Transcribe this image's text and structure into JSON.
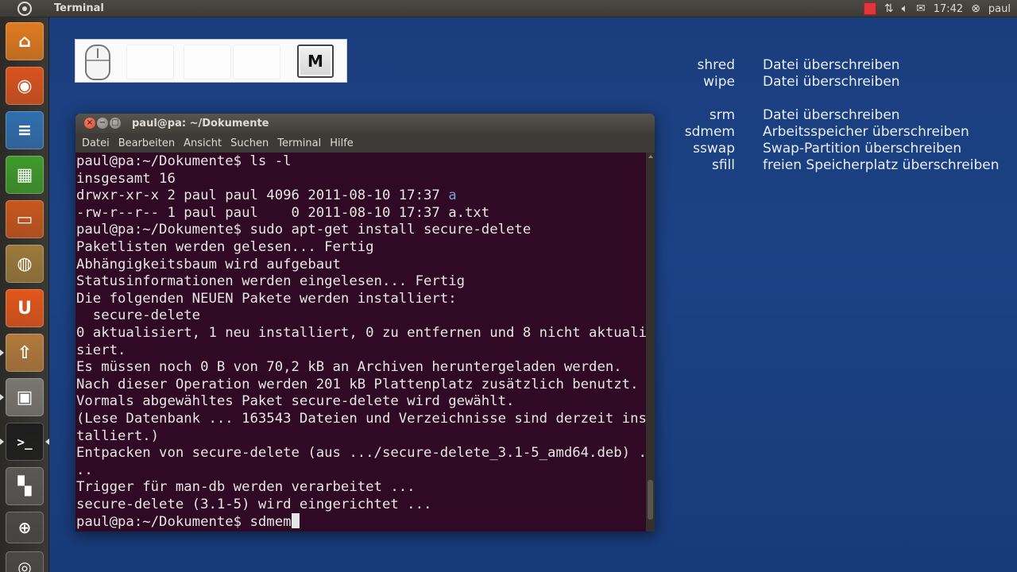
{
  "top_panel": {
    "app_title": "Terminal",
    "clock": "17:42",
    "user": "paul",
    "icons": [
      "ubuntu-logo-icon",
      "record-indicator-icon",
      "network-icon",
      "volume-icon",
      "mail-icon",
      "power-icon"
    ]
  },
  "launcher": {
    "items": [
      {
        "name": "home-folder-icon",
        "color": "#e07b1f",
        "glyph": "⌂"
      },
      {
        "name": "firefox-icon",
        "color": "#d9531e",
        "glyph": "◉"
      },
      {
        "name": "writer-icon",
        "color": "#2f6fb0",
        "glyph": "≡"
      },
      {
        "name": "calc-icon",
        "color": "#3f9a2b",
        "glyph": "▦"
      },
      {
        "name": "impress-icon",
        "color": "#c8561d",
        "glyph": "▭"
      },
      {
        "name": "software-center-icon",
        "color": "#9c7a3a",
        "glyph": "◍"
      },
      {
        "name": "ubuntu-one-icon",
        "color": "#e3561a",
        "glyph": "U"
      },
      {
        "name": "update-manager-icon",
        "color": "#b27a3c",
        "glyph": "⇧"
      },
      {
        "name": "keys-display-icon",
        "color": "#7a7772",
        "glyph": "▣"
      },
      {
        "name": "terminal-icon",
        "color": "#1d1d1d",
        "glyph": ">_"
      },
      {
        "name": "workspaces-icon",
        "color": "#5a5854",
        "glyph": "▚"
      },
      {
        "name": "zoom-icon",
        "color": "#4a4945",
        "glyph": "⊕"
      },
      {
        "name": "eye-icon",
        "color": "#4a4945",
        "glyph": "◎"
      }
    ]
  },
  "keys_overlay": {
    "pressed_key": "M"
  },
  "command_reference": [
    {
      "cmd": "shred",
      "desc": "Datei überschreiben"
    },
    {
      "cmd": "wipe",
      "desc": "Datei überschreiben"
    },
    {
      "cmd": "srm",
      "desc": "Datei überschreiben"
    },
    {
      "cmd": "sdmem",
      "desc": "Arbeitsspeicher überschreiben"
    },
    {
      "cmd": "sswap",
      "desc": "Swap-Partition überschreiben"
    },
    {
      "cmd": "sfill",
      "desc": "freien Speicherplatz überschreiben"
    }
  ],
  "terminal": {
    "title": "paul@pa: ~/Dokumente",
    "menu": [
      "Datei",
      "Bearbeiten",
      "Ansicht",
      "Suchen",
      "Terminal",
      "Hilfe"
    ],
    "lines": [
      "paul@pa:~/Dokumente$ ls -l",
      "insgesamt 16",
      "drwxr-xr-x 2 paul paul 4096 2011-08-10 17:37 ",
      "-rw-r--r-- 1 paul paul    0 2011-08-10 17:37 a.txt",
      "paul@pa:~/Dokumente$ sudo apt-get install secure-delete",
      "Paketlisten werden gelesen... Fertig",
      "Abhängigkeitsbaum wird aufgebaut",
      "Statusinformationen werden eingelesen... Fertig",
      "Die folgenden NEUEN Pakete werden installiert:",
      "  secure-delete",
      "0 aktualisiert, 1 neu installiert, 0 zu entfernen und 8 nicht aktuali",
      "siert.",
      "Es müssen noch 0 B von 70,2 kB an Archiven heruntergeladen werden.",
      "Nach dieser Operation werden 201 kB Plattenplatz zusätzlich benutzt.",
      "Vormals abgewähltes Paket secure-delete wird gewählt.",
      "(Lese Datenbank ... 163543 Dateien und Verzeichnisse sind derzeit ins",
      "talliert.)",
      "Entpacken von secure-delete (aus .../secure-delete_3.1-5_amd64.deb) .",
      "..",
      "Trigger für man-db werden verarbeitet ...",
      "secure-delete (3.1-5) wird eingerichtet ..."
    ],
    "dir_entry": "a",
    "prompt": "paul@pa:~/Dokumente$ ",
    "current_input": "sdmem",
    "colors": {
      "background": "#300a24",
      "text": "#e6e6e6",
      "directory": "#7b9ed8"
    }
  }
}
